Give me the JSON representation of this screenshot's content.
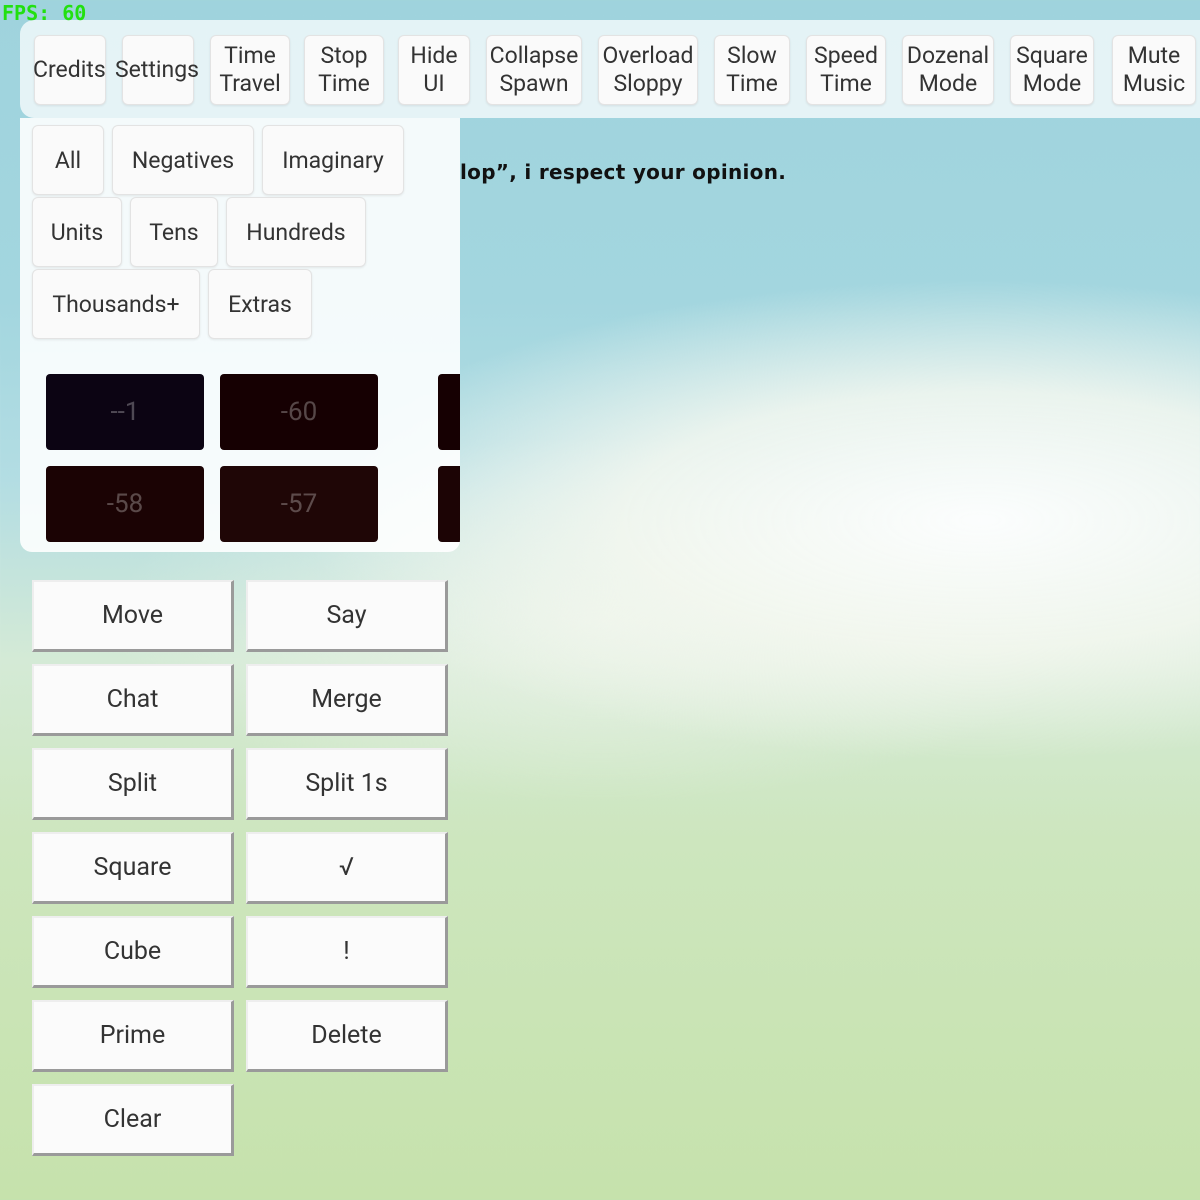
{
  "fps": "FPS: 60",
  "background_text": "lop”, i respect your opinion.",
  "toolbar": {
    "credits": "Credits",
    "settings": "Settings",
    "time_travel": "Time\nTravel",
    "stop_time": "Stop\nTime",
    "hide_ui": "Hide\nUI",
    "collapse_spawn": "Collapse\nSpawn",
    "overload_sloppy": "Overload\nSloppy",
    "slow_time": "Slow\nTime",
    "speed_time": "Speed\nTime",
    "dozenal_mode": "Dozenal\nMode",
    "square_mode": "Square\nMode",
    "mute_music": "Mute\nMusic"
  },
  "filters": {
    "all": "All",
    "negatives": "Negatives",
    "imaginary": "Imaginary",
    "units": "Units",
    "tens": "Tens",
    "hundreds": "Hundreds",
    "thousands": "Thousands+",
    "extras": "Extras"
  },
  "tiles": {
    "t1": "--1",
    "t2": "-60",
    "t3": "-58",
    "t4": "-57",
    "colors": [
      "#0c0413",
      "#160002",
      "#1b0304",
      "#1f0606"
    ]
  },
  "actions": {
    "move": "Move",
    "say": "Say",
    "chat": "Chat",
    "merge": "Merge",
    "split": "Split",
    "split_1s": "Split 1s",
    "square": "Square",
    "sqrt": "√",
    "cube": "Cube",
    "factorial": "!",
    "prime": "Prime",
    "delete": "Delete",
    "clear": "Clear"
  }
}
